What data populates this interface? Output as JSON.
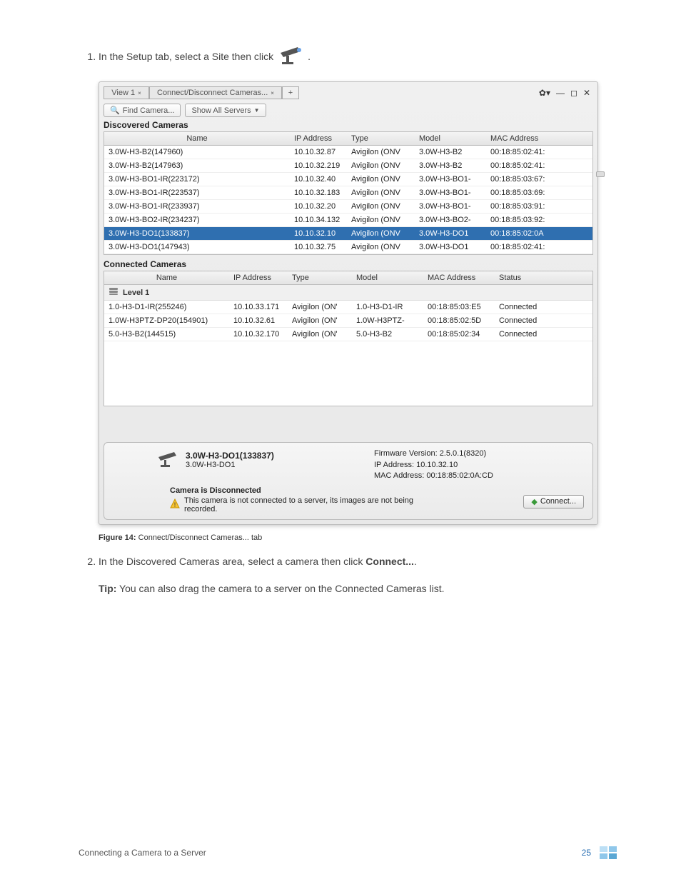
{
  "step1_pre": "In the Setup tab, select a Site then click",
  "step1_post": ".",
  "tabs": {
    "view": "View 1",
    "close": "×",
    "connect": "Connect/Disconnect Cameras...",
    "add": "+"
  },
  "toolbar": {
    "find": "Find Camera...",
    "show_all": "Show All Servers"
  },
  "discovered_title": "Discovered Cameras",
  "headers": {
    "name": "Name",
    "ip": "IP Address",
    "type": "Type",
    "model": "Model",
    "mac": "MAC Address",
    "status": "Status"
  },
  "discovered": [
    {
      "name": "3.0W-H3-B2(147960)",
      "ip": "10.10.32.87",
      "type": "Avigilon (ONV",
      "model": "3.0W-H3-B2",
      "mac": "00:18:85:02:41:"
    },
    {
      "name": "3.0W-H3-B2(147963)",
      "ip": "10.10.32.219",
      "type": "Avigilon (ONV",
      "model": "3.0W-H3-B2",
      "mac": "00:18:85:02:41:"
    },
    {
      "name": "3.0W-H3-BO1-IR(223172)",
      "ip": "10.10.32.40",
      "type": "Avigilon (ONV",
      "model": "3.0W-H3-BO1-",
      "mac": "00:18:85:03:67:"
    },
    {
      "name": "3.0W-H3-BO1-IR(223537)",
      "ip": "10.10.32.183",
      "type": "Avigilon (ONV",
      "model": "3.0W-H3-BO1-",
      "mac": "00:18:85:03:69:"
    },
    {
      "name": "3.0W-H3-BO1-IR(233937)",
      "ip": "10.10.32.20",
      "type": "Avigilon (ONV",
      "model": "3.0W-H3-BO1-",
      "mac": "00:18:85:03:91:"
    },
    {
      "name": "3.0W-H3-BO2-IR(234237)",
      "ip": "10.10.34.132",
      "type": "Avigilon (ONV",
      "model": "3.0W-H3-BO2-",
      "mac": "00:18:85:03:92:"
    },
    {
      "name": "3.0W-H3-DO1(133837)",
      "ip": "10.10.32.10",
      "type": "Avigilon (ONV",
      "model": "3.0W-H3-DO1",
      "mac": "00:18:85:02:0A",
      "selected": true
    },
    {
      "name": "3.0W-H3-DO1(147943)",
      "ip": "10.10.32.75",
      "type": "Avigilon (ONV",
      "model": "3.0W-H3-DO1",
      "mac": "00:18:85:02:41:"
    }
  ],
  "connected_title": "Connected Cameras",
  "group_label": "Level 1",
  "connected": [
    {
      "name": "1.0-H3-D1-IR(255246)",
      "ip": "10.10.33.171",
      "type": "Avigilon (ON'",
      "model": "1.0-H3-D1-IR",
      "mac": "00:18:85:03:E5",
      "status": "Connected"
    },
    {
      "name": "1.0W-H3PTZ-DP20(154901)",
      "ip": "10.10.32.61",
      "type": "Avigilon (ON'",
      "model": "1.0W-H3PTZ-",
      "mac": "00:18:85:02:5D",
      "status": "Connected"
    },
    {
      "name": "5.0-H3-B2(144515)",
      "ip": "10.10.32.170",
      "type": "Avigilon (ON'",
      "model": "5.0-H3-B2",
      "mac": "00:18:85:02:34",
      "status": "Connected"
    }
  ],
  "detail": {
    "name": "3.0W-H3-DO1(133837)",
    "subname": "3.0W-H3-DO1",
    "firmware": "Firmware Version: 2.5.0.1(8320)",
    "ip": "IP Address: 10.10.32.10",
    "mac": "MAC Address: 00:18:85:02:0A:CD",
    "disc_title": "Camera is Disconnected",
    "disc_msg": "This camera is not connected to a server, its images are not being recorded.",
    "connect_btn": "Connect..."
  },
  "figure": {
    "label": "Figure 14:",
    "text": " Connect/Disconnect Cameras... tab"
  },
  "step2_pre": "In the Discovered Cameras area, select a camera then click ",
  "step2_bold": "Connect...",
  "step2_post": ".",
  "tip_label": "Tip:",
  "tip_text": " You can also drag the camera to a server on the Connected Cameras list.",
  "footer": {
    "title": "Connecting a Camera to a Server",
    "page": "25"
  }
}
